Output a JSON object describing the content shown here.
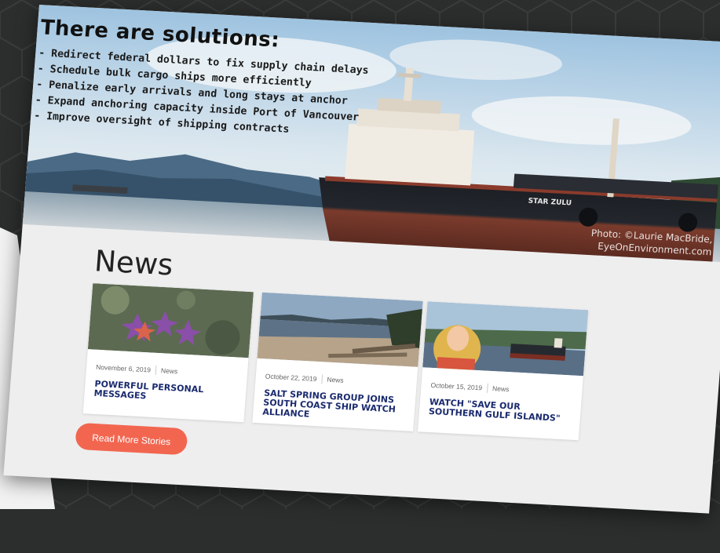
{
  "hero": {
    "title": "There are solutions:",
    "bullets": [
      "- Redirect federal dollars to fix supply chain delays",
      "- Schedule bulk cargo ships more efficiently",
      "- Penalize early arrivals and long stays at anchor",
      "- Expand anchoring capacity inside Port of Vancouver",
      "- Improve oversight of shipping contracts"
    ],
    "photo_credit_line1": "Photo: ©Laurie MacBride,",
    "photo_credit_line2": "EyeOnEnvironment.com",
    "ship_name": "STAR ZULU"
  },
  "news": {
    "heading": "News",
    "cards": [
      {
        "date": "November 6, 2019",
        "category": "News",
        "title": "POWERFUL PERSONAL MESSAGES"
      },
      {
        "date": "October 22, 2019",
        "category": "News",
        "title": "SALT SPRING GROUP JOINS SOUTH COAST SHIP WATCH ALLIANCE"
      },
      {
        "date": "October 15, 2019",
        "category": "News",
        "title": "WATCH \"SAVE OUR SOUTHERN GULF ISLANDS\""
      }
    ],
    "read_more_label": "Read More Stories"
  },
  "colors": {
    "accent_button": "#f26650",
    "card_title": "#1a2a6e",
    "page_background": "#eeeeee",
    "backdrop": "#2c2e2e"
  }
}
